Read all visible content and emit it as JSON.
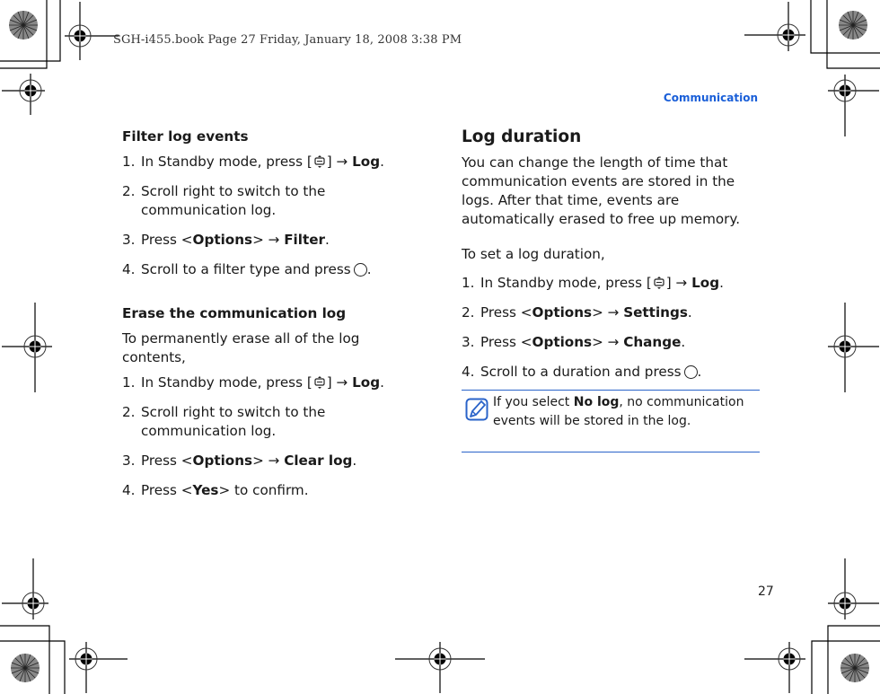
{
  "print_info": "SGH-i455.book  Page 27  Friday, January 18, 2008  3:38 PM",
  "section_header": "Communication",
  "accent_color": "#1a5fd8",
  "note_rule_color": "#2a63c9",
  "left_column": {
    "filter": {
      "heading": "Filter log events",
      "steps": [
        {
          "num": "1.",
          "pre": "In Standby mode, press [",
          "icon": "call-log-key-icon",
          "mid": "] → ",
          "bold": "Log",
          "post": "."
        },
        {
          "num": "2.",
          "text": "Scroll right to switch to the communication log."
        },
        {
          "num": "3.",
          "pre": "Press <",
          "bold1": "Options",
          "mid": "> → ",
          "bold2": "Filter",
          "post": "."
        },
        {
          "num": "4.",
          "pre": "Scroll to a filter type and press",
          "icon": "ok-key-icon",
          "post": "."
        }
      ]
    },
    "erase": {
      "heading": "Erase the communication log",
      "intro": "To permanently erase all of the log contents,",
      "steps": [
        {
          "num": "1.",
          "pre": "In Standby mode, press [",
          "icon": "call-log-key-icon",
          "mid": "] → ",
          "bold": "Log",
          "post": "."
        },
        {
          "num": "2.",
          "text": "Scroll right to switch to the communication log."
        },
        {
          "num": "3.",
          "pre": "Press <",
          "bold1": "Options",
          "mid": "> → ",
          "bold2": "Clear log",
          "post": "."
        },
        {
          "num": "4.",
          "pre": "Press <",
          "bold": "Yes",
          "post": "> to confirm."
        }
      ]
    }
  },
  "right_column": {
    "heading": "Log duration",
    "intro": "You can change the length of time that communication events are stored in the logs. After that time, events are automatically erased to free up memory.",
    "lead": "To set a log duration,",
    "steps": [
      {
        "num": "1.",
        "pre": "In Standby mode, press [",
        "icon": "call-log-key-icon",
        "mid": "] → ",
        "bold": "Log",
        "post": "."
      },
      {
        "num": "2.",
        "pre": "Press <",
        "bold1": "Options",
        "mid": "> → ",
        "bold2": "Settings",
        "post": "."
      },
      {
        "num": "3.",
        "pre": "Press <",
        "bold1": "Options",
        "mid": "> → ",
        "bold2": "Change",
        "post": "."
      },
      {
        "num": "4.",
        "pre": "Scroll to a duration and press",
        "icon": "ok-key-icon",
        "post": "."
      }
    ],
    "note": {
      "icon": "note-pencil-icon",
      "pre": "If you select ",
      "bold": "No log",
      "post": ", no communication events will be stored in the log."
    }
  },
  "page_number": "27"
}
